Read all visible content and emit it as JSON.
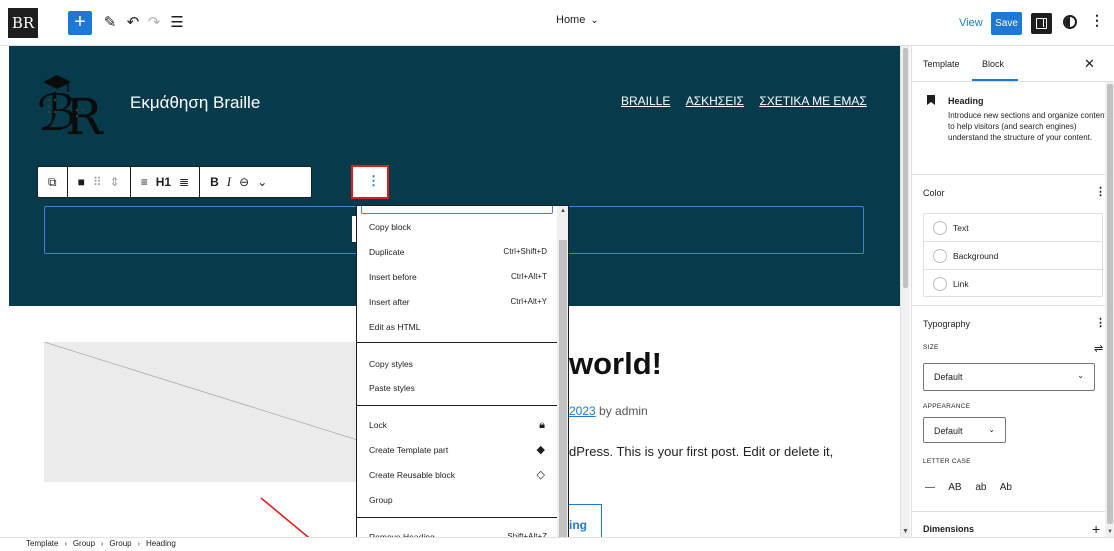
{
  "topbar": {
    "site_icon": "BR",
    "doc_title": "Home",
    "view_label": "View",
    "save_label": "Save",
    "icons": [
      "plus-icon",
      "pencil-icon",
      "undo-icon",
      "redo-icon",
      "list-view-icon",
      "chevron-down-icon",
      "sidebar-icon",
      "styles-icon",
      "options-icon"
    ]
  },
  "site": {
    "title": "Εκμάθηση Braille",
    "nav": [
      "BRAILLE",
      "ΑΣΚΗΣΕΙΣ",
      "ΣΧΕΤΙΚΑ ΜΕ ΕΜΑΣ"
    ]
  },
  "block_toolbar": {
    "heading_level": "H1",
    "bold": "B",
    "italic": "I"
  },
  "post": {
    "title": "world!",
    "meta_date": "2023",
    "meta_by": " by admin",
    "excerpt": "dPress. This is your first post. Edit or delete it,",
    "read_more": "ing"
  },
  "menu": {
    "items": [
      {
        "label": "Copy block",
        "shortcut": ""
      },
      {
        "label": "Duplicate",
        "shortcut": "Ctrl+Shift+D"
      },
      {
        "label": "Insert before",
        "shortcut": "Ctrl+Alt+T"
      },
      {
        "label": "Insert after",
        "shortcut": "Ctrl+Alt+Y"
      },
      {
        "label": "Edit as HTML",
        "shortcut": ""
      },
      {
        "label": "Copy styles",
        "shortcut": ""
      },
      {
        "label": "Paste styles",
        "shortcut": ""
      },
      {
        "label": "Lock",
        "shortcut": "",
        "icon": "lock-icon"
      },
      {
        "label": "Create Template part",
        "shortcut": "",
        "icon": "template-part-icon"
      },
      {
        "label": "Create Reusable block",
        "shortcut": "",
        "icon": "reusable-block-icon"
      },
      {
        "label": "Group",
        "shortcut": ""
      },
      {
        "label": "Remove Heading",
        "shortcut": "Shift+Alt+Z"
      }
    ]
  },
  "sidebar": {
    "tabs": [
      "Template",
      "Block"
    ],
    "active_tab": "Block",
    "block_title": "Heading",
    "block_desc": "Introduce new sections and organize content to help visitors (and search engines) understand the structure of your content.",
    "color_title": "Color",
    "colors": [
      "Text",
      "Background",
      "Link"
    ],
    "typography_title": "Typography",
    "size_label": "SIZE",
    "size_value": "Default",
    "appearance_label": "APPEARANCE",
    "appearance_value": "Default",
    "letter_case_label": "LETTER CASE",
    "letter_case": [
      "—",
      "AB",
      "ab",
      "Ab"
    ],
    "dimensions_title": "Dimensions"
  },
  "breadcrumb": [
    "Template",
    "Group",
    "Group",
    "Heading"
  ],
  "colors": {
    "accent": "#1e78d6",
    "header_bg": "#073b4c",
    "highlight": "#d62020"
  }
}
